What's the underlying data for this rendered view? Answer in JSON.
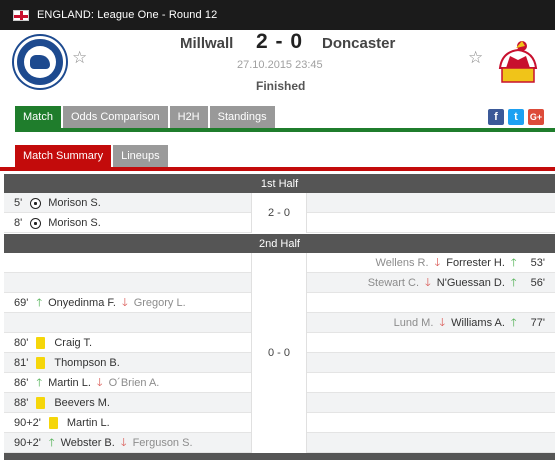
{
  "header": {
    "competition": "ENGLAND: League One - Round 12"
  },
  "match": {
    "home_team": "Millwall",
    "away_team": "Doncaster",
    "score": "2 - 0",
    "datetime": "27.10.2015 23:45",
    "status": "Finished"
  },
  "icons": {
    "favorite": "star-outline-icon",
    "flag": "england-flag-icon"
  },
  "tabs": [
    {
      "label": "Match",
      "active": true
    },
    {
      "label": "Odds Comparison",
      "active": false
    },
    {
      "label": "H2H",
      "active": false
    },
    {
      "label": "Standings",
      "active": false
    }
  ],
  "social": {
    "facebook": "f",
    "twitter": "t",
    "google": "G+"
  },
  "subtabs": [
    {
      "label": "Match Summary",
      "active": true
    },
    {
      "label": "Lineups",
      "active": false
    }
  ],
  "first_half": {
    "title": "1st Half",
    "score": "2 - 0",
    "events": [
      {
        "minute": "5'",
        "player": "Morison S."
      },
      {
        "minute": "8'",
        "player": "Morison S."
      }
    ]
  },
  "second_half": {
    "title": "2nd Half",
    "score": "0 - 0",
    "away_events": [
      {
        "minute": "53'",
        "in": "Forrester H.",
        "out": "Wellens R."
      },
      {
        "minute": "56'",
        "in": "N'Guessan D.",
        "out": "Stewart C."
      },
      {
        "minute": "77'",
        "in": "Williams A.",
        "out": "Lund M."
      }
    ],
    "home_events": [
      {
        "minute": "69'",
        "type": "sub",
        "in": "Onyedinma F.",
        "out": "Gregory L."
      },
      {
        "minute": "80'",
        "type": "card",
        "player": "Craig T."
      },
      {
        "minute": "81'",
        "type": "card",
        "player": "Thompson B."
      },
      {
        "minute": "86'",
        "type": "sub",
        "in": "Martin L.",
        "out": "O´Brien A."
      },
      {
        "minute": "88'",
        "type": "card",
        "player": "Beevers M."
      },
      {
        "minute": "90+2'",
        "type": "card",
        "player": "Martin L."
      },
      {
        "minute": "90+2'",
        "type": "sub",
        "in": "Webster B.",
        "out": "Ferguson S."
      }
    ]
  },
  "colors": {
    "tab_active": "#1f7d2c",
    "subtab_active": "#c30b0b",
    "yellow_card": "#f5d60a"
  }
}
